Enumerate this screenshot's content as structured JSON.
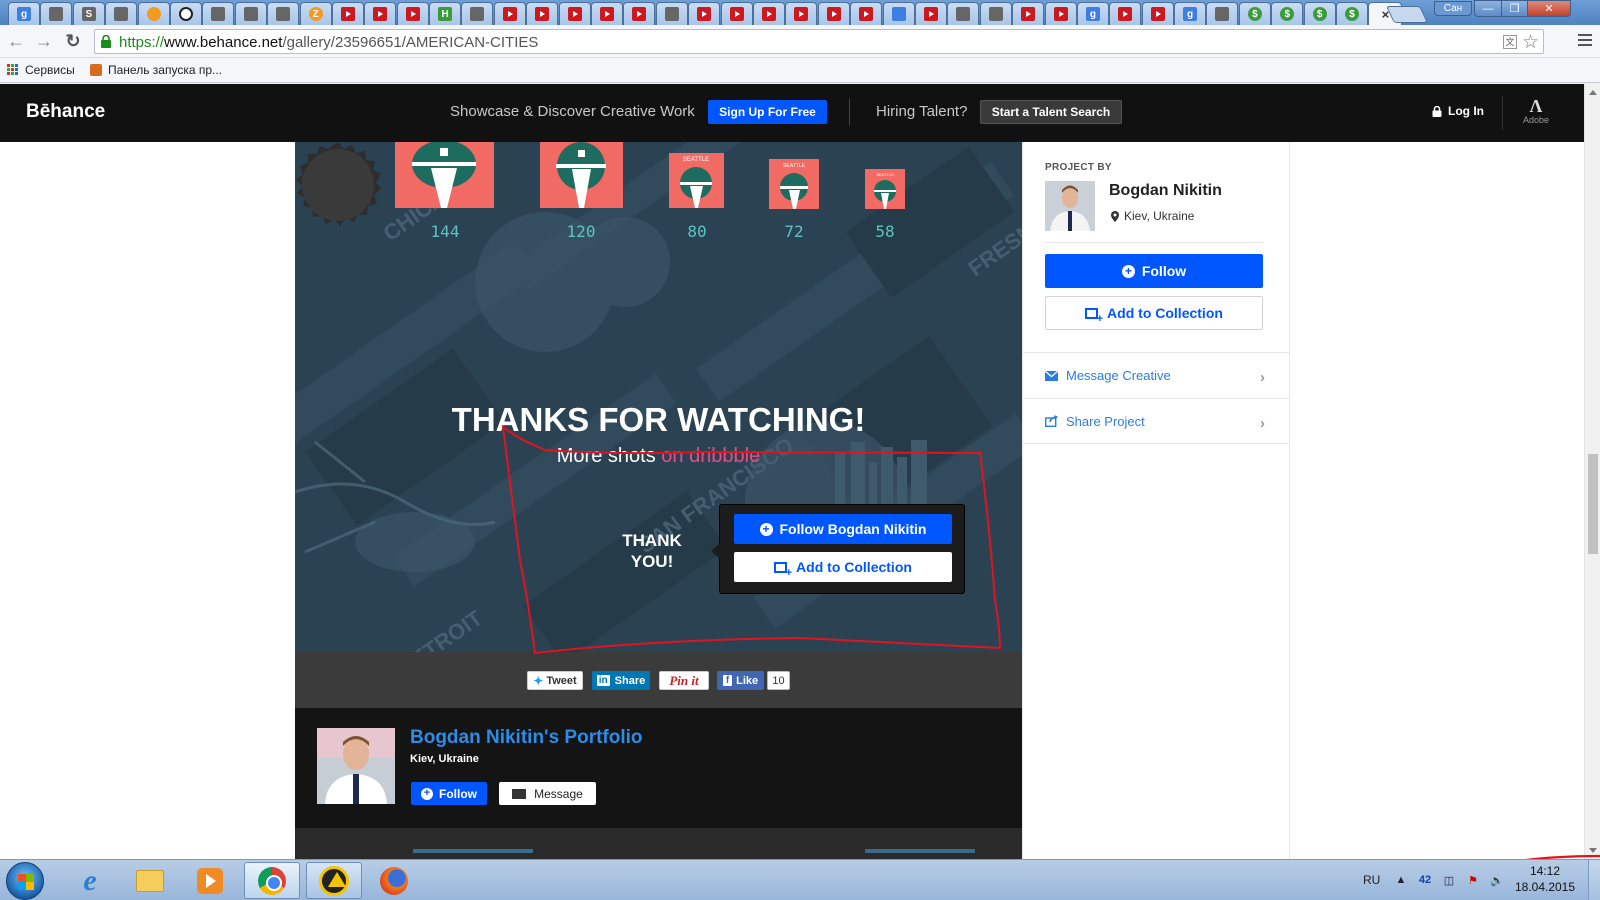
{
  "browser": {
    "tabs": [
      {
        "icon": "google-icon",
        "type": "g"
      },
      {
        "icon": "gamepad-icon",
        "type": "misc"
      },
      {
        "icon": "s-icon",
        "type": "misc"
      },
      {
        "icon": "snowflake-icon",
        "type": "misc"
      },
      {
        "icon": "orange-icon",
        "type": "orange"
      },
      {
        "icon": "football-icon",
        "type": "ball"
      },
      {
        "icon": "vk-icon",
        "type": "misc"
      },
      {
        "icon": "globe-icon",
        "type": "misc"
      },
      {
        "icon": "drop-icon",
        "type": "misc"
      },
      {
        "icon": "z-icon",
        "type": "orange"
      },
      {
        "icon": "t-icon",
        "type": "yt"
      },
      {
        "icon": "youtube-icon",
        "type": "yt"
      },
      {
        "icon": "rss-icon",
        "type": "yt"
      },
      {
        "icon": "h-icon",
        "type": "h"
      },
      {
        "icon": "chart-icon",
        "type": "misc"
      },
      {
        "icon": "youtube-icon",
        "type": "yt"
      },
      {
        "icon": "youtube-icon",
        "type": "yt"
      },
      {
        "icon": "youtube-icon",
        "type": "yt"
      },
      {
        "icon": "youtube-icon",
        "type": "yt"
      },
      {
        "icon": "youtube-icon",
        "type": "yt"
      },
      {
        "icon": "skull-icon",
        "type": "misc"
      },
      {
        "icon": "youtube-icon",
        "type": "yt"
      },
      {
        "icon": "youtube-icon",
        "type": "yt"
      },
      {
        "icon": "youtube-icon",
        "type": "yt"
      },
      {
        "icon": "youtube-icon",
        "type": "yt"
      },
      {
        "icon": "youtube-icon",
        "type": "yt"
      },
      {
        "icon": "youtube-icon",
        "type": "yt"
      },
      {
        "icon": "pin-icon",
        "type": "g"
      },
      {
        "icon": "youtube-icon",
        "type": "yt"
      },
      {
        "icon": "dice-icon",
        "type": "misc"
      },
      {
        "icon": "gear-icon",
        "type": "misc"
      },
      {
        "icon": "emblem-icon",
        "type": "yt"
      },
      {
        "icon": "youtube-icon",
        "type": "yt"
      },
      {
        "icon": "google-icon",
        "type": "g"
      },
      {
        "icon": "youtube-icon",
        "type": "yt"
      },
      {
        "icon": "youtube-icon",
        "type": "yt"
      },
      {
        "icon": "google-icon",
        "type": "g"
      },
      {
        "icon": "star-icon",
        "type": "misc"
      },
      {
        "icon": "dollar-icon",
        "type": "s"
      },
      {
        "icon": "dollar-icon",
        "type": "s"
      },
      {
        "icon": "dollar-icon",
        "type": "s"
      },
      {
        "icon": "dollar-icon",
        "type": "s"
      }
    ],
    "tab_letters": {
      "google-icon": "g",
      "s-icon": "S",
      "t-icon": "T",
      "h-icon": "H",
      "z-icon": "Z",
      "dollar-icon": "$"
    },
    "active_tab_close": "×",
    "user_label": "Сан",
    "window_buttons": {
      "minimize": "—",
      "maximize": "❐",
      "close": "✕"
    },
    "url": {
      "scheme": "https://",
      "host": "www.behance.net",
      "path": "/gallery/23596651/AMERICAN-CITIES"
    },
    "bookmarks": [
      {
        "label": "Сервисы",
        "icon": "apps-grid-icon"
      },
      {
        "label": "Панель запуска пр...",
        "icon": "app-launcher-icon"
      }
    ]
  },
  "behance": {
    "logo": "Bēhance",
    "tagline": "Showcase & Discover Creative Work",
    "signup_label": "Sign Up For Free",
    "hiring_label": "Hiring Talent?",
    "talent_search_label": "Start a Talent Search",
    "login_label": "Log In",
    "adobe_label": "Adobe"
  },
  "project": {
    "icon_sizes": [
      "144",
      "120",
      "80",
      "72",
      "58"
    ],
    "tile_text": "SEATTLE",
    "city_watermarks": [
      "CHICAGO",
      "SAN FRANCISCO",
      "DETROIT",
      "FRESNO"
    ],
    "thanks_title": "THANKS FOR WATCHING!",
    "more_shots_prefix": "More shots",
    "more_shots_link": "on dribbble",
    "thank_you_badge": [
      "THANK",
      "YOU!"
    ],
    "cta_follow_label": "Follow Bogdan Nikitin",
    "cta_collection_label": "Add to Collection"
  },
  "share": {
    "tweet": "Tweet",
    "linkedin": "Share",
    "linkedin_icon_text": "in",
    "pinterest": "Pin it",
    "facebook": "Like",
    "facebook_count": "10"
  },
  "owner": {
    "portfolio_title": "Bogdan Nikitin's Portfolio",
    "location": "Kiev, Ukraine",
    "follow_label": "Follow",
    "message_label": "Message"
  },
  "sidebar": {
    "project_by_label": "PROJECT BY",
    "name": "Bogdan Nikitin",
    "location": "Kiev, Ukraine",
    "follow_label": "Follow",
    "add_collection_label": "Add to Collection",
    "message_label": "Message Creative",
    "share_label": "Share Project"
  },
  "taskbar": {
    "apps": [
      "internet-explorer-icon",
      "windows-explorer-icon",
      "media-player-icon",
      "chrome-icon",
      "aimp-icon",
      "firefox-icon"
    ],
    "language": "RU",
    "tray_count": "42",
    "time": "14:12",
    "date": "18.04.2015"
  },
  "colors": {
    "behance_blue": "#0057ff",
    "art_background": "#2b4252",
    "tile_coral": "#f16a63",
    "teal_label": "#5bc6c0",
    "dribbble_pink": "#ea4c89",
    "annotation_red": "#e0141e"
  }
}
